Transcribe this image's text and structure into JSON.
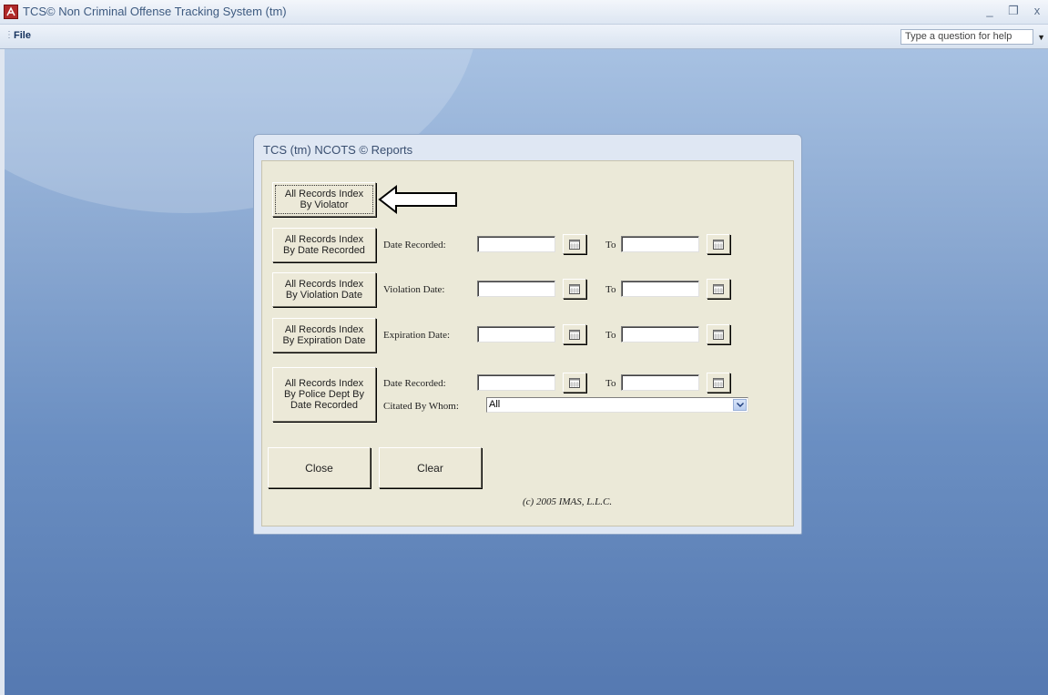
{
  "window": {
    "title": "TCS© Non Criminal Offense Tracking System (tm)",
    "controls": {
      "minimize": "_",
      "restore": "❐",
      "close": "x"
    }
  },
  "menu": {
    "file": "File",
    "help_placeholder": "Type a question for help"
  },
  "dialog": {
    "title": "TCS (tm) NCOTS © Reports",
    "reports": [
      {
        "button": "All Records Index\nBy Violator"
      },
      {
        "button": "All Records Index\nBy Date Recorded",
        "label": "Date Recorded:",
        "to": "To"
      },
      {
        "button": "All Records Index\nBy Violation Date",
        "label": "Violation Date:",
        "to": "To"
      },
      {
        "button": "All Records Index\nBy Expiration Date",
        "label": "Expiration Date:",
        "to": "To"
      },
      {
        "button": "All Records Index\nBy Police Dept By\nDate Recorded",
        "label": "Date Recorded:",
        "to": "To",
        "citated_label": "Citated By Whom:",
        "citated_value": "All"
      }
    ],
    "close_label": "Close",
    "clear_label": "Clear",
    "copyright": "(c) 2005 IMAS, L.L.C."
  },
  "colors": {
    "workspace": "#6b8fc2",
    "dialog_body": "#ebe9d8"
  }
}
